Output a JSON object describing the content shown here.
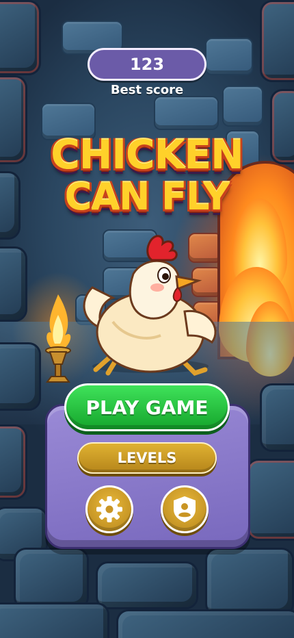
{
  "best_score": {
    "value": "123",
    "label": "Best score"
  },
  "title": {
    "line1": "CHICKEN",
    "line2": "CAN FLY"
  },
  "menu": {
    "play_label": "PLAY GAME",
    "levels_label": "LEVELS",
    "settings_icon": "gear-icon",
    "profile_icon": "shield-user-icon"
  },
  "colors": {
    "play_green": "#22b83a",
    "levels_gold": "#d2a027",
    "score_pill_purple": "#6b5ba8",
    "title_yellow": "#ffd12a"
  }
}
